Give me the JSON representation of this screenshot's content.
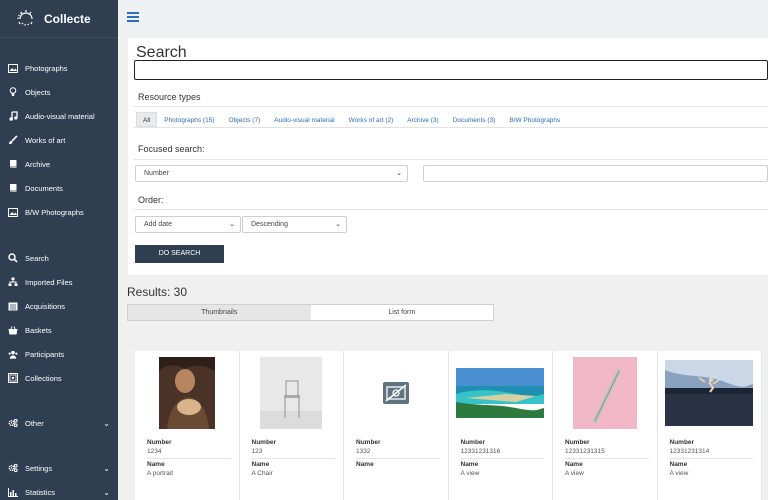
{
  "app": {
    "name": "Collecte"
  },
  "sidebar": {
    "items": [
      {
        "label": "Photographs",
        "icon": "image-icon"
      },
      {
        "label": "Objects",
        "icon": "bulb-icon"
      },
      {
        "label": "Audio-visual material",
        "icon": "music-note-icon"
      },
      {
        "label": "Works of art",
        "icon": "brush-icon"
      },
      {
        "label": "Archive",
        "icon": "book-icon"
      },
      {
        "label": "Documents",
        "icon": "book-icon"
      },
      {
        "label": "B/W Photographs",
        "icon": "image-icon"
      },
      {
        "label": "Search",
        "icon": "search-icon"
      },
      {
        "label": "Imported Files",
        "icon": "sitemap-icon"
      },
      {
        "label": "Acquisitions",
        "icon": "list-icon"
      },
      {
        "label": "Baskets",
        "icon": "basket-icon"
      },
      {
        "label": "Participants",
        "icon": "users-icon"
      },
      {
        "label": "Collections",
        "icon": "collections-icon"
      },
      {
        "label": "Other",
        "icon": "cogs-icon"
      },
      {
        "label": "Settings",
        "icon": "cogs-icon"
      },
      {
        "label": "Statistics",
        "icon": "bar-chart-icon"
      }
    ]
  },
  "search": {
    "title": "Search",
    "value": "",
    "resource_types_label": "Resource types",
    "tabs": [
      "All",
      "Photographs (15)",
      "Objects (7)",
      "Audio-visual material",
      "Works of art (2)",
      "Archive (3)",
      "Documents (3)",
      "B/W Photographs"
    ],
    "focused_label": "Focused search:",
    "focused_field": "Number",
    "focused_value": "",
    "order_label": "Order:",
    "order_by": "Add date",
    "order_dir": "Descending",
    "button": "DO SEARCH"
  },
  "results": {
    "title": "Results: 30",
    "views": [
      "Thumbnails",
      "List form"
    ],
    "number_label": "Number",
    "name_label": "Name",
    "cards": [
      {
        "number": "1234",
        "name": "A portrait",
        "thumb": "painting"
      },
      {
        "number": "123",
        "name": "A Chair",
        "thumb": "chair"
      },
      {
        "number": "1332",
        "name": "",
        "thumb": "no-image"
      },
      {
        "number": "12331231316",
        "name": "A view",
        "thumb": "beach"
      },
      {
        "number": "12331231315",
        "name": "A view",
        "thumb": "pen"
      },
      {
        "number": "12331231314",
        "name": "A view",
        "thumb": "lake"
      }
    ]
  },
  "colors": {
    "sidebar": "#2f3f51",
    "accent": "#2a6fb8"
  }
}
